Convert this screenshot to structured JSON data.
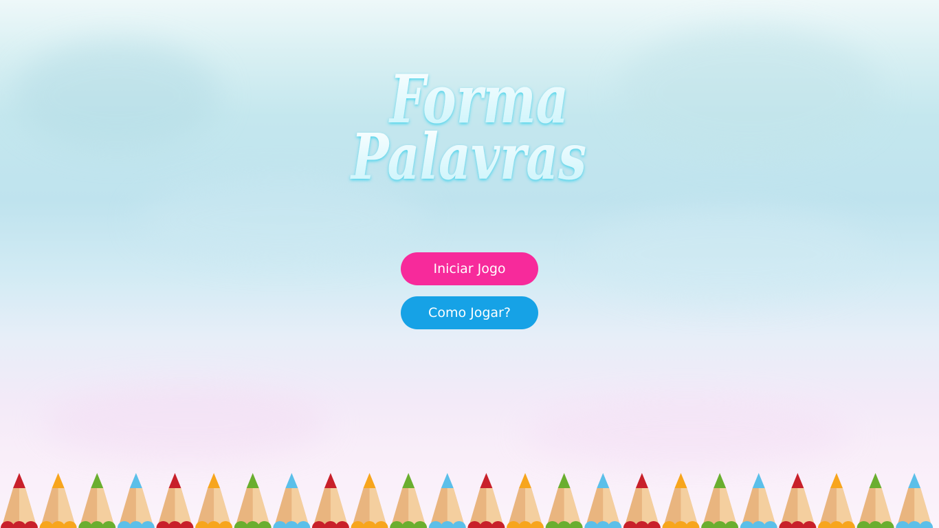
{
  "logo": {
    "line1": "Forma",
    "line2": "Palavras",
    "color_fill": "#ffffff",
    "color_shadow": "#4fd9ef"
  },
  "menu": {
    "start_label": "Iniciar Jogo",
    "how_to_play_label": "Como Jogar?",
    "start_color": "#f72a9b",
    "how_to_play_color": "#16a2e6"
  },
  "decor": {
    "pencil_row_icon": "colored-pencils-row",
    "pencil_colors": [
      "#c8202a",
      "#f7a51d",
      "#6aae2f",
      "#5bbfe9"
    ],
    "pencil_count": 24
  }
}
